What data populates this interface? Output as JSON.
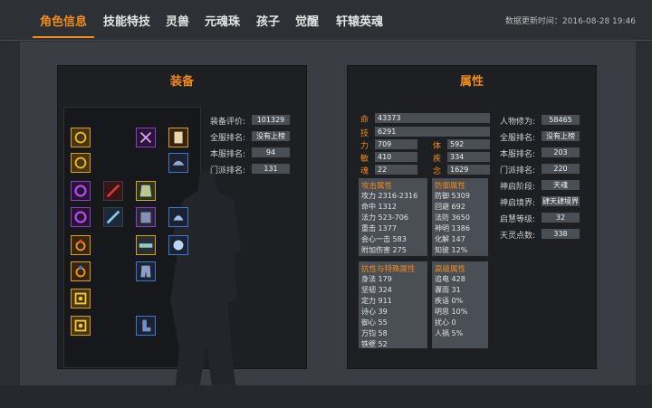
{
  "tabs": [
    {
      "label": "角色信息",
      "active": true
    },
    {
      "label": "技能特技"
    },
    {
      "label": "灵兽"
    },
    {
      "label": "元魂珠"
    },
    {
      "label": "孩子"
    },
    {
      "label": "觉醒"
    },
    {
      "label": "轩辕英魂"
    }
  ],
  "update_label": "数据更新时间：",
  "update_time": "2016-08-28 19:46",
  "equip": {
    "title": "装备",
    "rows": [
      {
        "label": "装备评价:",
        "value": "101329"
      },
      {
        "label": "全服排名:",
        "value": "没有上榜"
      },
      {
        "label": "本服排名:",
        "value": "94"
      },
      {
        "label": "门派排名:",
        "value": "131"
      }
    ],
    "left_slots": [
      "ring-icon",
      "ring-icon",
      "bracelet-icon",
      "bracelet-icon",
      "ring-icon",
      "ring-icon",
      "amulet-icon",
      "amulet-icon"
    ],
    "right_slots": [
      "weapon-icon",
      "scroll-icon",
      "shoulder-icon",
      "cape-icon",
      "armor-icon",
      "helmet-icon",
      "belt-icon",
      "gauntlet-icon",
      "pants-icon",
      "boots-icon"
    ]
  },
  "attr": {
    "title": "属性",
    "basic": [
      {
        "label": "命",
        "value": "43373"
      },
      {
        "label": "技",
        "value": "6291"
      }
    ],
    "pairs": [
      {
        "l1": "力",
        "v1": "709",
        "l2": "体",
        "v2": "592"
      },
      {
        "l1": "敏",
        "v1": "410",
        "l2": "疾",
        "v2": "334"
      },
      {
        "l1": "魂",
        "v1": "22",
        "l2": "念",
        "v2": "1629"
      }
    ],
    "attack": {
      "title": "攻击属性",
      "lines": [
        {
          "label": "攻力",
          "value": "2316-2316"
        },
        {
          "label": "命中",
          "value": "1312"
        },
        {
          "label": "法力",
          "value": "523-706"
        },
        {
          "label": "重击",
          "value": "1377"
        },
        {
          "label": "会心一击",
          "value": "583"
        },
        {
          "label": "附加伤害",
          "value": "275"
        }
      ]
    },
    "defense": {
      "title": "防御属性",
      "lines": [
        {
          "label": "防御",
          "value": "5309"
        },
        {
          "label": "回避",
          "value": "692"
        },
        {
          "label": "法防",
          "value": "3650"
        },
        {
          "label": "神明",
          "value": "1386"
        },
        {
          "label": "化解",
          "value": "147"
        },
        {
          "label": "知彼",
          "value": "12%"
        }
      ]
    },
    "resist": {
      "title": "抗性与特殊属性",
      "lines": [
        {
          "label": "身法",
          "value": "179"
        },
        {
          "label": "坚韧",
          "value": "324"
        },
        {
          "label": "定力",
          "value": "911"
        },
        {
          "label": "诗心",
          "value": "39"
        },
        {
          "label": "御心",
          "value": "55"
        },
        {
          "label": "万钧",
          "value": "58"
        },
        {
          "label": "铁壁",
          "value": "52"
        }
      ]
    },
    "advanced": {
      "title": "高级属性",
      "lines": [
        {
          "label": "追电",
          "value": "428"
        },
        {
          "label": "骤雨",
          "value": "31"
        },
        {
          "label": "疾语",
          "value": "0%"
        },
        {
          "label": "明思",
          "value": "10%"
        },
        {
          "label": "扰心",
          "value": "0"
        },
        {
          "label": "人祸",
          "value": "5%"
        }
      ]
    },
    "right_rows": [
      {
        "label": "人物修为:",
        "value": "58465"
      },
      {
        "label": "全服排名:",
        "value": "没有上榜"
      },
      {
        "label": "本服排名:",
        "value": "203"
      },
      {
        "label": "门派排名:",
        "value": "220"
      },
      {
        "label": "神启阶段:",
        "value": "天魂"
      },
      {
        "label": "神启境界:",
        "value": "肆天肆境界"
      },
      {
        "label": "启慧等级:",
        "value": "32"
      },
      {
        "label": "天灵点数:",
        "value": "338"
      }
    ]
  },
  "colors": {
    "accent": "#f08a1c",
    "gold_border": "#d4a21c",
    "purple_border": "#8a3fc4",
    "blue_border": "#3f78c8"
  }
}
